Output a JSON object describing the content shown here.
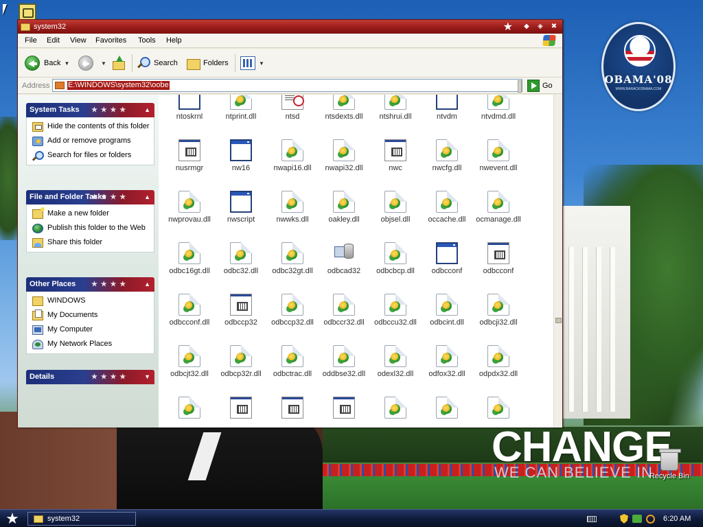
{
  "window": {
    "title": "system32",
    "menu": [
      "File",
      "Edit",
      "View",
      "Favorites",
      "Tools",
      "Help"
    ],
    "toolbar": {
      "back_label": "Back",
      "search_label": "Search",
      "folders_label": "Folders"
    },
    "address": {
      "label": "Address",
      "value": "E:\\WINDOWS\\system32\\oobe",
      "go_label": "Go"
    },
    "taskpane": {
      "system_tasks": {
        "title": "System Tasks",
        "items": [
          {
            "label": "Hide the contents of this folder",
            "icon": "hide-folder-icon"
          },
          {
            "label": "Add or remove programs",
            "icon": "add-remove-icon"
          },
          {
            "label": "Search for files or folders",
            "icon": "search-icon"
          }
        ]
      },
      "file_folder_tasks": {
        "title": "File and Folder Tasks",
        "items": [
          {
            "label": "Make a new folder",
            "icon": "new-folder-icon"
          },
          {
            "label": "Publish this folder to the Web",
            "icon": "publish-web-icon"
          },
          {
            "label": "Share this folder",
            "icon": "share-folder-icon"
          }
        ]
      },
      "other_places": {
        "title": "Other Places",
        "items": [
          {
            "label": "WINDOWS",
            "icon": "folder-icon"
          },
          {
            "label": "My Documents",
            "icon": "my-documents-icon"
          },
          {
            "label": "My Computer",
            "icon": "my-computer-icon"
          },
          {
            "label": "My Network Places",
            "icon": "network-places-icon"
          }
        ]
      },
      "details": {
        "title": "Details"
      }
    },
    "files": [
      {
        "name": "ntoskrnl",
        "type": "exe"
      },
      {
        "name": "ntprint.dll",
        "type": "dll"
      },
      {
        "name": "ntsd",
        "type": "log"
      },
      {
        "name": "ntsdexts.dll",
        "type": "dll"
      },
      {
        "name": "ntshrui.dll",
        "type": "dll"
      },
      {
        "name": "ntvdm",
        "type": "exe"
      },
      {
        "name": "ntvdmd.dll",
        "type": "dll"
      },
      {
        "name": "nusrmgr",
        "type": "sys"
      },
      {
        "name": "nw16",
        "type": "exe"
      },
      {
        "name": "nwapi16.dll",
        "type": "dll"
      },
      {
        "name": "nwapi32.dll",
        "type": "dll"
      },
      {
        "name": "nwc",
        "type": "sys"
      },
      {
        "name": "nwcfg.dll",
        "type": "dll"
      },
      {
        "name": "nwevent.dll",
        "type": "dll"
      },
      {
        "name": "nwprovau.dll",
        "type": "dll"
      },
      {
        "name": "nwscript",
        "type": "exe"
      },
      {
        "name": "nwwks.dll",
        "type": "dll"
      },
      {
        "name": "oakley.dll",
        "type": "dll"
      },
      {
        "name": "objsel.dll",
        "type": "dll"
      },
      {
        "name": "occache.dll",
        "type": "dll"
      },
      {
        "name": "ocmanage.dll",
        "type": "dll"
      },
      {
        "name": "odbc16gt.dll",
        "type": "dll"
      },
      {
        "name": "odbc32.dll",
        "type": "dll"
      },
      {
        "name": "odbc32gt.dll",
        "type": "dll"
      },
      {
        "name": "odbcad32",
        "type": "odbcad"
      },
      {
        "name": "odbcbcp.dll",
        "type": "dll"
      },
      {
        "name": "odbcconf",
        "type": "exe"
      },
      {
        "name": "odbcconf",
        "type": "sys"
      },
      {
        "name": "odbcconf.dll",
        "type": "dll"
      },
      {
        "name": "odbccp32",
        "type": "sys"
      },
      {
        "name": "odbccp32.dll",
        "type": "dll"
      },
      {
        "name": "odbccr32.dll",
        "type": "dll"
      },
      {
        "name": "odbccu32.dll",
        "type": "dll"
      },
      {
        "name": "odbcint.dll",
        "type": "dll"
      },
      {
        "name": "odbcji32.dll",
        "type": "dll"
      },
      {
        "name": "odbcjt32.dll",
        "type": "dll"
      },
      {
        "name": "odbcp32r.dll",
        "type": "dll"
      },
      {
        "name": "odbctrac.dll",
        "type": "dll"
      },
      {
        "name": "oddbse32.dll",
        "type": "dll"
      },
      {
        "name": "odexl32.dll",
        "type": "dll"
      },
      {
        "name": "odfox32.dll",
        "type": "dll"
      },
      {
        "name": "odpdx32.dll",
        "type": "dll"
      },
      {
        "name": "",
        "type": "dll"
      },
      {
        "name": "",
        "type": "sys"
      },
      {
        "name": "",
        "type": "sys"
      },
      {
        "name": "",
        "type": "sys"
      },
      {
        "name": "",
        "type": "dll"
      },
      {
        "name": "",
        "type": "dll"
      },
      {
        "name": "",
        "type": "dll"
      }
    ]
  },
  "desktop": {
    "obama_logo_text": "OBAMA'08",
    "obama_logo_sub": "WWW.BARACKOBAMA.COM",
    "change_text": "CHANGE",
    "change_sub": "WE CAN BELIEVE IN",
    "recycle_bin_label": "Recycle Bin"
  },
  "taskbar": {
    "task_label": "system32",
    "clock": "6:20 AM"
  },
  "colors": {
    "titlebar": "#9a1c19",
    "address_highlight": "#a51a16",
    "taskpane_header_blue": "#1c2f7a",
    "taskpane_header_red": "#b3202d",
    "taskbar": "#101c3c"
  }
}
